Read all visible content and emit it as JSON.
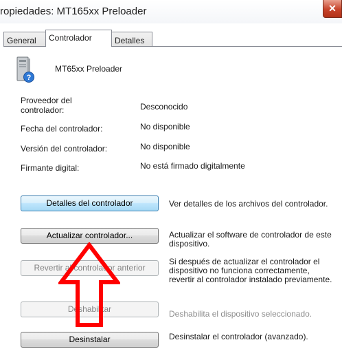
{
  "window": {
    "title": "ropiedades: MT165xx Preloader",
    "close_label": "✕"
  },
  "tabs": [
    {
      "label": "General",
      "active": false
    },
    {
      "label": "Controlador",
      "active": true
    },
    {
      "label": "Detalles",
      "active": false
    }
  ],
  "device": {
    "icon": "computer-tower-help-icon",
    "name": "MT65xx Preloader"
  },
  "properties": [
    {
      "label": "Proveedor del controlador:",
      "value": "Desconocido"
    },
    {
      "label": "Fecha del controlador:",
      "value": "No disponible"
    },
    {
      "label": "Versión del controlador:",
      "value": "No disponible"
    },
    {
      "label": "Firmante digital:",
      "value": "No está firmado digitalmente"
    }
  ],
  "actions": [
    {
      "button": "Detalles del controlador",
      "description": "Ver detalles de los archivos del controlador.",
      "enabled": true
    },
    {
      "button": "Actualizar controlador...",
      "description": "Actualizar el software de controlador de este dispositivo.",
      "enabled": true
    },
    {
      "button": "Revertir al controlador anterior",
      "description": "Si después de actualizar el controlador el dispositivo no funciona correctamente, revertir al controlador instalado previamente.",
      "enabled": false
    },
    {
      "button": "Deshabilitar",
      "description": "Deshabilita el dispositivo seleccionado.",
      "enabled": false
    },
    {
      "button": "Desinstalar",
      "description": "Desinstalar el controlador (avanzado).",
      "enabled": true
    }
  ],
  "annotation": {
    "icon": "red-up-arrow-icon",
    "color": "#ff0000"
  }
}
